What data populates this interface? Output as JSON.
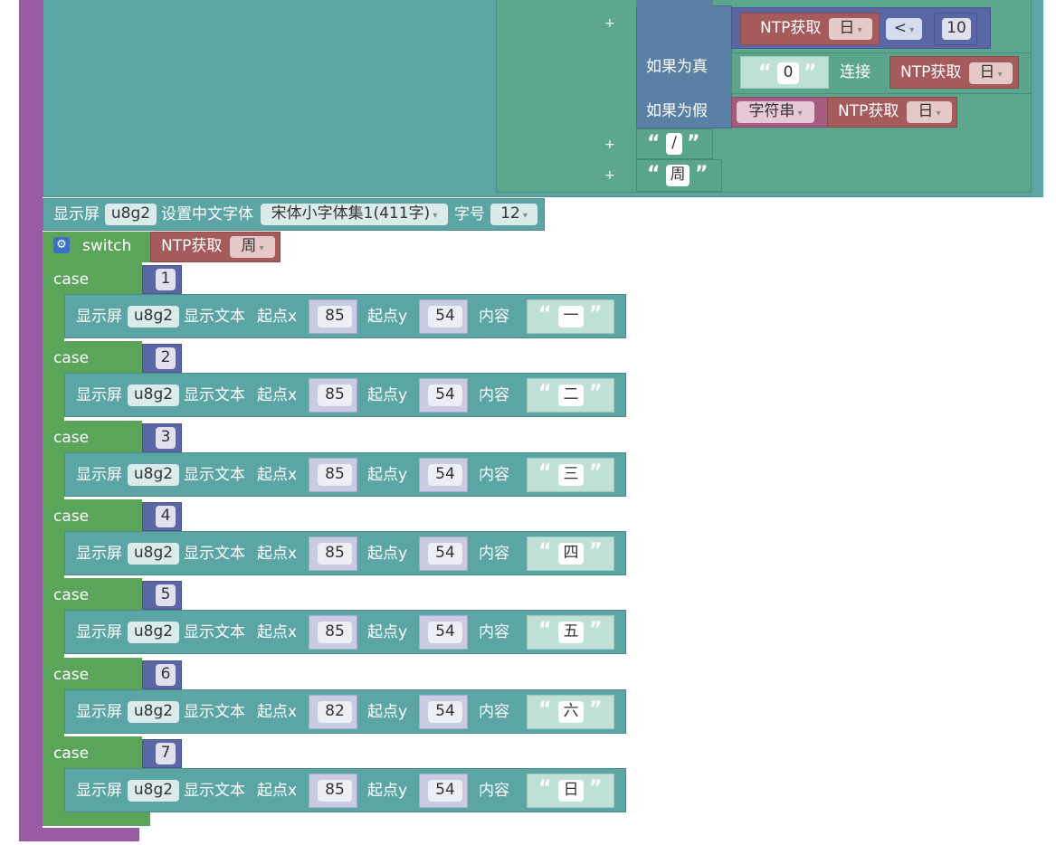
{
  "ntp_label": "NTP获取",
  "ntp_day": "日",
  "ntp_week": "周",
  "compare_op": "<",
  "compare_value": "10",
  "if_true_label": "如果为真",
  "if_false_label": "如果为假",
  "zero_str": "0",
  "concat_label": "连接",
  "string_label": "字符串",
  "plus": "+",
  "slash_str": "/",
  "week_str": "周",
  "font_block": {
    "display": "显示屏",
    "device": "u8g2",
    "set_font": "设置中文字体",
    "font": "宋体小字体集1(411字)",
    "size_label": "字号",
    "size": "12"
  },
  "switch_label": "switch",
  "case_label": "case",
  "text_block": {
    "display": "显示屏",
    "device": "u8g2",
    "show_text": "显示文本",
    "x_label": "起点x",
    "y_label": "起点y",
    "content_label": "内容"
  },
  "cases": [
    {
      "n": "1",
      "x": "85",
      "y": "54",
      "text": "一"
    },
    {
      "n": "2",
      "x": "85",
      "y": "54",
      "text": "二"
    },
    {
      "n": "3",
      "x": "85",
      "y": "54",
      "text": "三"
    },
    {
      "n": "4",
      "x": "85",
      "y": "54",
      "text": "四"
    },
    {
      "n": "5",
      "x": "85",
      "y": "54",
      "text": "五"
    },
    {
      "n": "6",
      "x": "82",
      "y": "54",
      "text": "六"
    },
    {
      "n": "7",
      "x": "85",
      "y": "54",
      "text": "日"
    }
  ],
  "colors": {
    "procedure": "#9a5ba5",
    "display": "#5ba5a5",
    "logic": "#5ba55b",
    "math": "#5b67a5",
    "text": "#5ba58c",
    "ntp": "#a55b5b",
    "condition": "#5b80a5"
  }
}
